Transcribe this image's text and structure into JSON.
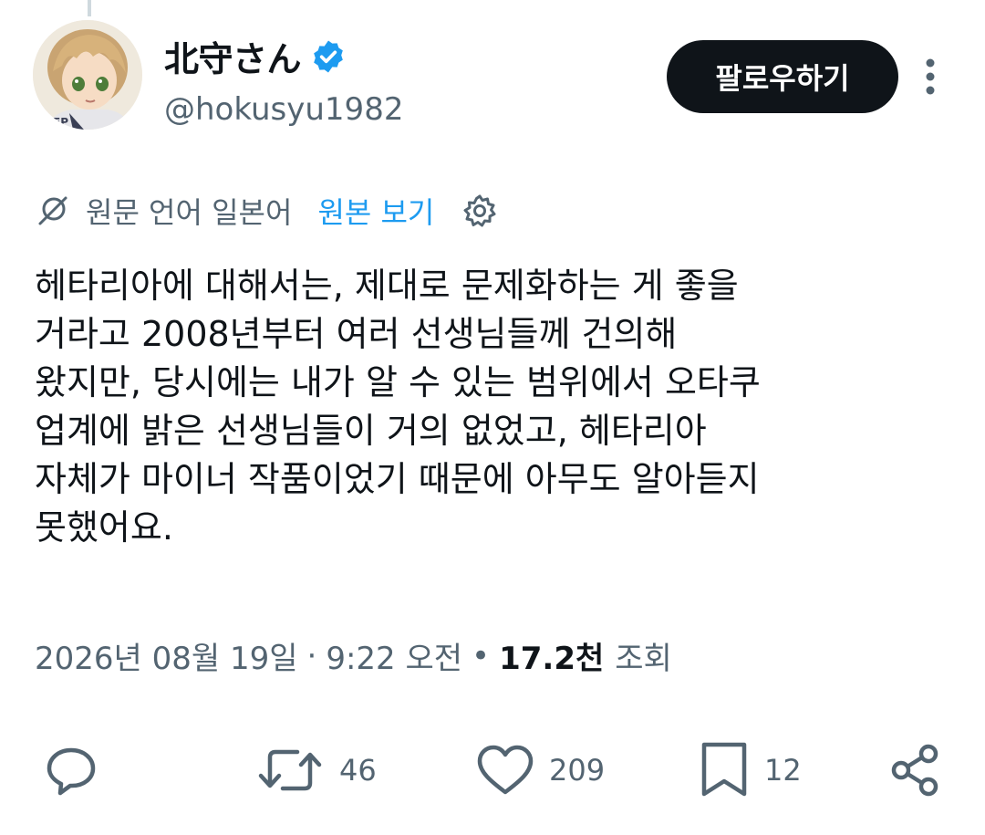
{
  "author": {
    "display_name": "北守さん",
    "handle": "@hokusyu1982",
    "verified": true,
    "avatar_icon": "anime-character-avatar"
  },
  "header": {
    "follow_label": "팔로우하기",
    "more_icon": "more-vertical-icon"
  },
  "translation": {
    "icon": "translate-icon",
    "source_language": "원문 언어 일본어",
    "view_original": "원본 보기",
    "settings_icon": "gear-icon"
  },
  "tweet": {
    "text": "헤타리아에 대해서는, 제대로 문제화하는 게 좋을\n거라고 2008년부터 여러 선생님들께 건의해\n왔지만, 당시에는 내가 알 수 있는 범위에서 오타쿠\n업계에 밝은 선생님들이 거의 없었고, 헤타리아\n자체가 마이너 작품이었기 때문에 아무도 알아듣지\n못했어요."
  },
  "meta": {
    "date": "2026년 08월 19일",
    "separator": "·",
    "time": "9:22 오전",
    "views_separator": "•",
    "views_count": "17.2천",
    "views_label": "조회"
  },
  "actions": {
    "reply": {
      "icon": "reply-icon"
    },
    "retweet": {
      "icon": "retweet-icon",
      "count": "46"
    },
    "like": {
      "icon": "heart-icon",
      "count": "209"
    },
    "bookmark": {
      "icon": "bookmark-icon",
      "count": "12"
    },
    "share": {
      "icon": "share-icon"
    }
  },
  "colors": {
    "accent": "#1d9bf0",
    "text_primary": "#0f1419",
    "text_secondary": "#536471",
    "button_bg": "#0f1419",
    "divider": "#cfd9de"
  }
}
